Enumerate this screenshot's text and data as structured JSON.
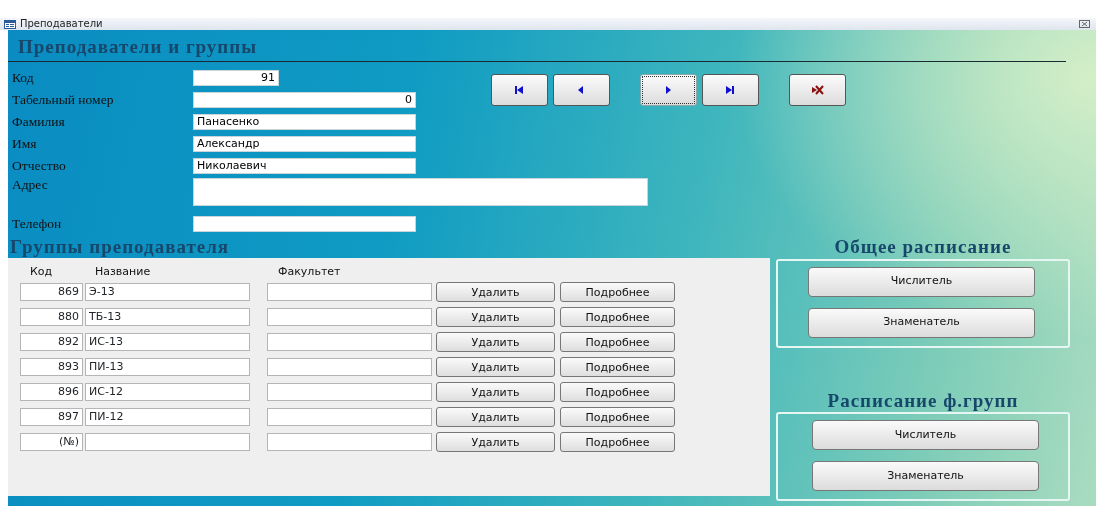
{
  "window": {
    "title": "Преподаватели"
  },
  "form": {
    "heading": "Преподаватели и группы",
    "fields": [
      {
        "label": "Код",
        "value": "91",
        "kind": "id"
      },
      {
        "label": "Табельный номер",
        "value": "0",
        "kind": "number"
      },
      {
        "label": "Фамилия",
        "value": "Панасенко",
        "kind": "text"
      },
      {
        "label": "Имя",
        "value": "Александр",
        "kind": "text"
      },
      {
        "label": "Отчество",
        "value": "Николаевич",
        "kind": "text"
      },
      {
        "label": "Адрес",
        "kind": "memo"
      },
      {
        "label": "Телефон",
        "kind": "text"
      }
    ],
    "nav_groups": [
      [
        {
          "kind": "first",
          "focused": false
        },
        {
          "kind": "prev",
          "focused": false
        }
      ],
      [
        {
          "kind": "next",
          "focused": true
        },
        {
          "kind": "last",
          "focused": false
        }
      ],
      [
        {
          "kind": "delete",
          "focused": false
        }
      ]
    ]
  },
  "subform": {
    "heading": "Группы преподавателя",
    "columns": [
      "Код",
      "Название",
      "Факультет"
    ],
    "rows": [
      {
        "code": "869",
        "name": "Э-13",
        "buttons": [
          "Удалить",
          "Подробнее"
        ]
      },
      {
        "code": "880",
        "name": "ТБ-13",
        "buttons": [
          "Удалить",
          "Подробнее"
        ]
      },
      {
        "code": "892",
        "name": "ИС-13",
        "buttons": [
          "Удалить",
          "Подробнее"
        ]
      },
      {
        "code": "893",
        "name": "ПИ-13",
        "buttons": [
          "Удалить",
          "Подробнее"
        ]
      },
      {
        "code": "896",
        "name": "ИС-12",
        "buttons": [
          "Удалить",
          "Подробнее"
        ]
      },
      {
        "code": "897",
        "name": "ПИ-12",
        "buttons": [
          "Удалить",
          "Подробнее"
        ]
      },
      {
        "code": "(№)",
        "buttons": [
          "Удалить",
          "Подробнее"
        ]
      }
    ]
  },
  "schedules": [
    {
      "heading": "Общее расписание",
      "buttons": [
        "Числитель",
        "Знаменатель"
      ]
    },
    {
      "heading": "Расписание ф.групп",
      "buttons": [
        "Числитель",
        "Знаменатель"
      ]
    }
  ]
}
